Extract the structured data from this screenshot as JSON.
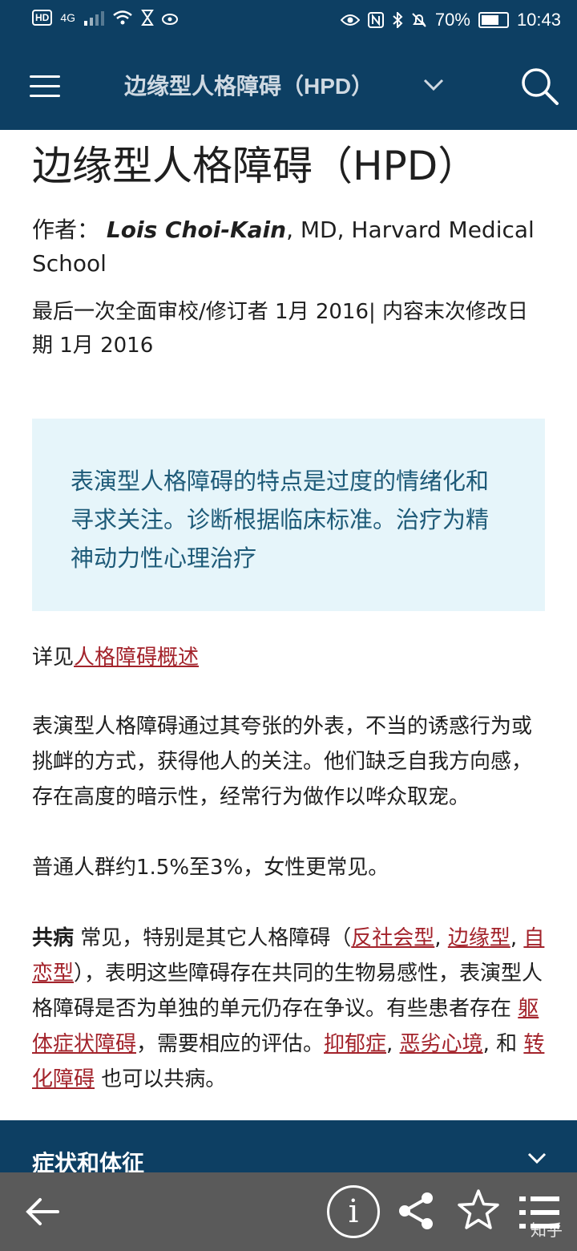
{
  "status_bar": {
    "left_badge": "HD",
    "network": "4G",
    "battery": "70%",
    "battery_level": 0.7,
    "time": "10:43"
  },
  "app_bar": {
    "title": "边缘型人格障碍（HPD）"
  },
  "article": {
    "title": "边缘型人格障碍（HPD）",
    "author_label": "作者：",
    "author_name": "Lois Choi-Kain",
    "author_affiliation": ", MD, Harvard Medical School",
    "revision": "最后一次全面审校/修订者 1月 2016| 内容末次修改日期 1月 2016",
    "summary": "表演型人格障碍的特点是过度的情绪化和寻求关注。诊断根据临床标准。治疗为精神动力性心理治疗",
    "see_also_prefix": "详见",
    "see_also_link": "人格障碍概述",
    "p1": "表演型人格障碍通过其夸张的外表，不当的诱惑行为或挑衅的方式，获得他人的关注。他们缺乏自我方向感，存在高度的暗示性，经常行为做作以哗众取宠。",
    "p2": "普通人群约1.5%至3%，女性更常见。",
    "p3": {
      "bold": "共病",
      "t1": " 常见，特别是其它人格障碍（",
      "l1": "反社会型",
      "t2": ", ",
      "l2": "边缘型",
      "t3": ", ",
      "l3": "自恋型",
      "t4": "），表明这些障碍存在共同的生物易感性，表演型人格障碍是否为单独的单元仍存在争议。有些患者存在 ",
      "l4": "躯体症状障碍",
      "t5": "，需要相应的评估。",
      "l5": "抑郁症",
      "t6": ", ",
      "l6": "恶劣心境",
      "t7": ", 和 ",
      "l7": "转化障碍",
      "t8": " 也可以共病。"
    }
  },
  "section": {
    "title": "症状和体征"
  },
  "bottom_nav": {
    "info_label": "i",
    "watermark": "知乎"
  },
  "icons": [
    "menu-icon",
    "chevron-down-icon",
    "search-icon",
    "back-arrow-icon",
    "info-icon",
    "share-icon",
    "star-icon",
    "list-icon"
  ],
  "colors": {
    "header": "#0d3f63",
    "summary_bg": "#e6f5fa",
    "summary_text": "#1d5a78",
    "link": "#a3232b",
    "bottom_nav": "#5a5a5a"
  }
}
